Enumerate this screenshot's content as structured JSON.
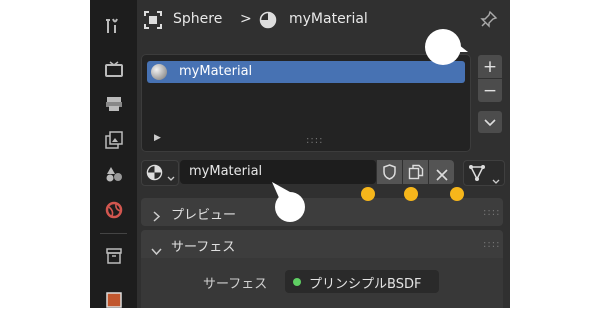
{
  "breadcrumb": {
    "object_name": "Sphere",
    "separator": ">",
    "material_name": "myMaterial"
  },
  "slot_list": {
    "items": [
      {
        "label": "myMaterial",
        "selected": true
      }
    ],
    "grip": "::::"
  },
  "side_buttons": {
    "add": "+",
    "remove": "−"
  },
  "material_row": {
    "name_value": "myMaterial"
  },
  "panels": {
    "preview": {
      "title": "プレビュー",
      "expanded": false
    },
    "surface": {
      "title": "サーフェス",
      "expanded": true,
      "field_label": "サーフェス",
      "field_value": "プリンシプルBSDF",
      "node_dot_color": "#5fcf63"
    }
  },
  "colors": {
    "accent_blue": "#4772b3",
    "marker_yellow": "#f6b61b",
    "panel_bg": "#303030",
    "tabstrip_bg": "#1d1d1d"
  }
}
